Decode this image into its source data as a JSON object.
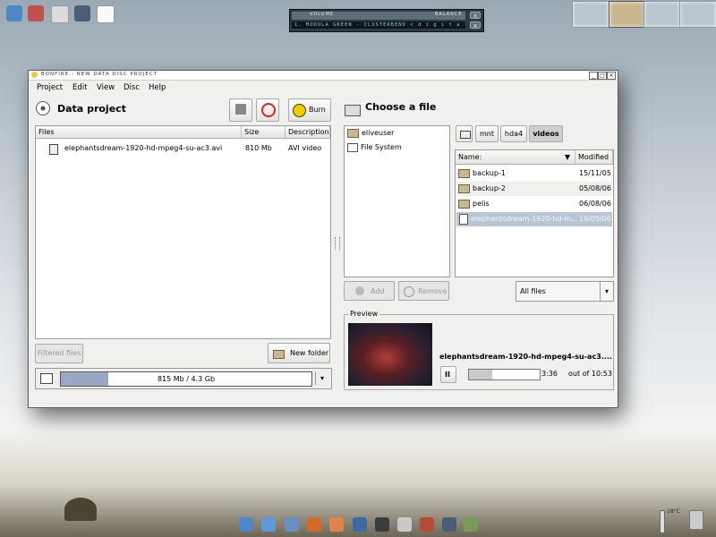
{
  "player": {
    "volume_label": "VOLUME",
    "balance_label": "BALANCE",
    "track": "1. MODULA GREEN - CLUSTERBEND < d i g i t a l...",
    "close": "×",
    "shade": "×"
  },
  "window": {
    "title": "BONFIRE - NEW DATA DISC PROJECT",
    "btn_min": "_",
    "btn_max": "□",
    "btn_close": "×"
  },
  "menu": [
    "Project",
    "Edit",
    "View",
    "Disc",
    "Help"
  ],
  "project": {
    "title": "Data project",
    "burn_label": "Burn",
    "columns": [
      "Files",
      "Size",
      "Description"
    ],
    "files": [
      {
        "name": "elephantsdream-1920-hd-mpeg4-su-ac3.avi",
        "size": "810 Mb",
        "desc": "AVI video"
      }
    ],
    "filtered_label": "Filtered files",
    "new_folder_label": "New folder",
    "capacity_text": "815 Mb / 4.3 Gb",
    "capacity_fraction": 0.19
  },
  "chooser": {
    "title": "Choose a file",
    "places": [
      "eliveuser",
      "File System"
    ],
    "path": [
      "mnt",
      "hda4",
      "videos"
    ],
    "columns": [
      "Name:",
      "Modified"
    ],
    "entries": [
      {
        "name": "backup-1",
        "date": "15/11/05",
        "type": "folder"
      },
      {
        "name": "backup-2",
        "date": "05/08/06",
        "type": "folder"
      },
      {
        "name": "pelis",
        "date": "06/08/06",
        "type": "folder"
      },
      {
        "name": "elephantsdream-1920-hd-m...",
        "date": "18/05/06",
        "type": "file"
      }
    ],
    "add_label": "Add",
    "remove_label": "Remove",
    "filter_value": "All files"
  },
  "preview": {
    "label": "Preview",
    "filename": "elephantsdream-1920-hd-mpeg4-su-ac3....",
    "time": "3:36",
    "total": "out of 10:53",
    "progress_fraction": 0.33,
    "pause": "II"
  },
  "tray": {
    "temp": "18°C"
  }
}
